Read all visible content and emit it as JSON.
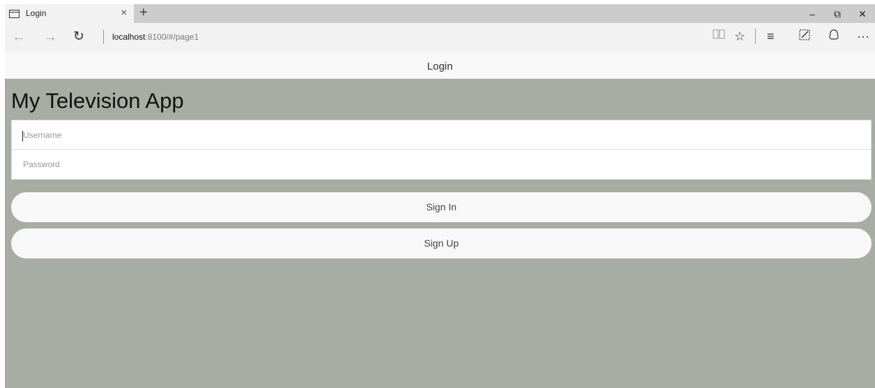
{
  "browser": {
    "tab": {
      "title": "Login",
      "close_glyph": "×",
      "icon": "page-icon"
    },
    "new_tab_glyph": "+",
    "window": {
      "minimize": "–",
      "restore": "⧉",
      "close": "✕"
    },
    "nav": {
      "back": "←",
      "forward": "→",
      "refresh": "↻"
    },
    "url": {
      "host": "localhost",
      "path": ":8100/#/page1"
    },
    "toolbar": {
      "reading_view": "📖",
      "favorite": "☆",
      "hub": "≡",
      "web_note": "✎",
      "share": "♲",
      "more": "···"
    }
  },
  "app": {
    "header_title": "Login",
    "title": "My Television App",
    "username": {
      "value": "",
      "placeholder": "Username"
    },
    "password": {
      "value": "",
      "placeholder": "Password"
    },
    "signin_label": "Sign In",
    "signup_label": "Sign Up",
    "colors": {
      "background": "#a7ada2",
      "header": "#f8f8f8",
      "button": "#f8f8f8"
    }
  }
}
